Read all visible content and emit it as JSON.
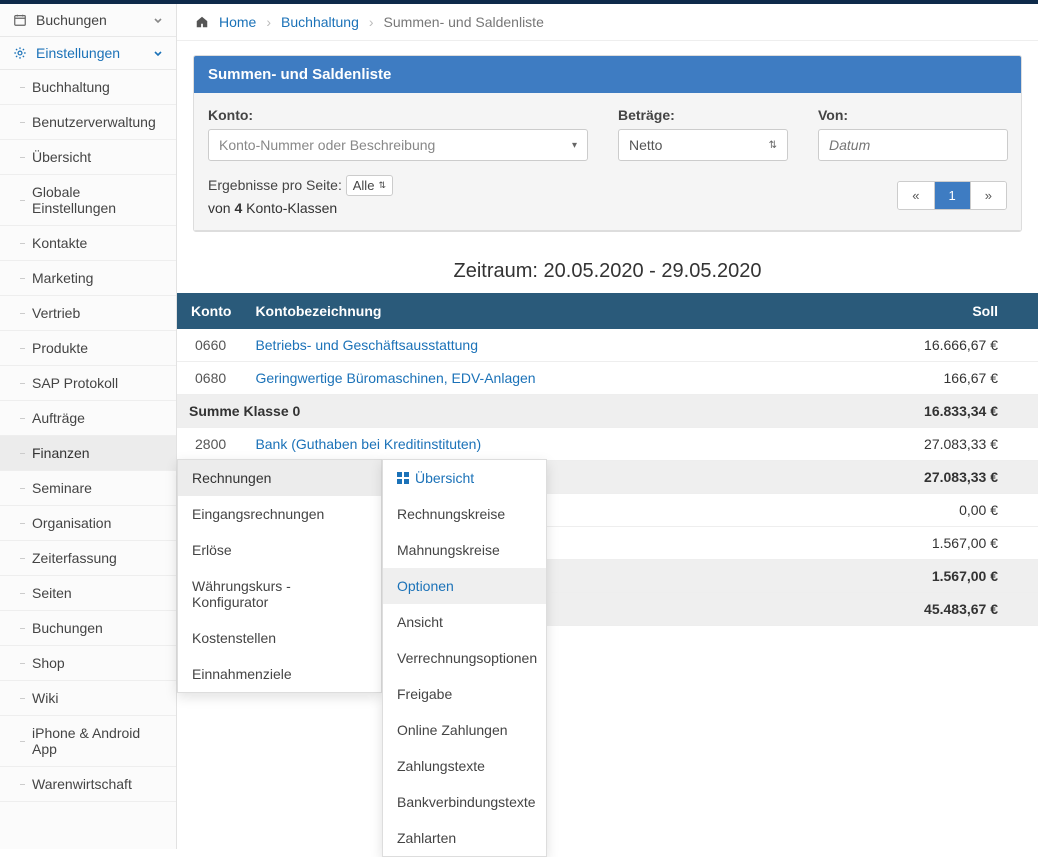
{
  "sidebar": {
    "groups": [
      {
        "icon": "calendar",
        "label": "Buchungen",
        "expanded": false
      },
      {
        "icon": "gear",
        "label": "Einstellungen",
        "expanded": true,
        "active": true,
        "items": [
          {
            "label": "Buchhaltung"
          },
          {
            "label": "Benutzerverwaltung"
          },
          {
            "label": "Übersicht"
          },
          {
            "label": "Globale Einstellungen"
          },
          {
            "label": "Kontakte"
          },
          {
            "label": "Marketing"
          },
          {
            "label": "Vertrieb"
          },
          {
            "label": "Produkte"
          },
          {
            "label": "SAP Protokoll"
          },
          {
            "label": "Aufträge"
          },
          {
            "label": "Finanzen",
            "active": true
          },
          {
            "label": "Seminare"
          },
          {
            "label": "Organisation"
          },
          {
            "label": "Zeiterfassung"
          },
          {
            "label": "Seiten"
          },
          {
            "label": "Buchungen"
          },
          {
            "label": "Shop"
          },
          {
            "label": "Wiki"
          },
          {
            "label": "iPhone & Android App"
          },
          {
            "label": "Warenwirtschaft"
          }
        ]
      }
    ]
  },
  "breadcrumb": {
    "home": "Home",
    "mid": "Buchhaltung",
    "tail": "Summen- und Saldenliste"
  },
  "panel": {
    "title": "Summen- und Saldenliste",
    "konto_label": "Konto:",
    "konto_placeholder": "Konto-Nummer oder Beschreibung",
    "betraege_label": "Beträge:",
    "betraege_value": "Netto",
    "von_label": "Von:",
    "von_placeholder": "Datum",
    "results_prefix": "Ergebnisse pro Seite:",
    "results_select": "Alle",
    "results_line2_pre": "von ",
    "results_count": "4",
    "results_line2_post": " Konto-Klassen",
    "pager_prev": "«",
    "pager_page": "1",
    "pager_next": "»"
  },
  "zeitraum": "Zeitraum: 20.05.2020 - 29.05.2020",
  "table": {
    "headers": {
      "konto": "Konto",
      "bez": "Kontobezeichnung",
      "soll": "Soll"
    },
    "rows": [
      {
        "type": "d",
        "acc": "0660",
        "desc": "Betriebs- und Geschäftsausstattung",
        "soll": "16.666,67 €"
      },
      {
        "type": "d",
        "acc": "0680",
        "desc": "Geringwertige Büromaschinen, EDV-Anlagen",
        "soll": "166,67 €"
      },
      {
        "type": "s",
        "desc": "Summe Klasse 0",
        "soll": "16.833,34 €"
      },
      {
        "type": "d",
        "acc": "2800",
        "desc": "Bank (Guthaben bei Kreditinstituten)",
        "soll": "27.083,33 €"
      },
      {
        "type": "s",
        "desc": "Summe Klasse 2",
        "soll": "27.083,33 €"
      },
      {
        "type": "d",
        "acc": "",
        "desc": "",
        "soll": "0,00 €"
      },
      {
        "type": "d",
        "acc": "",
        "desc": "",
        "soll": "1.567,00 €"
      },
      {
        "type": "s",
        "desc": "",
        "soll": "1.567,00 €"
      },
      {
        "type": "s",
        "desc": "",
        "soll": "45.483,67 €"
      }
    ]
  },
  "flyout1": [
    {
      "label": "Rechnungen",
      "active": true
    },
    {
      "label": "Eingangsrechnungen"
    },
    {
      "label": "Erlöse"
    },
    {
      "label": "Währungskurs - Konfigurator"
    },
    {
      "label": "Kostenstellen"
    },
    {
      "label": "Einnahmenziele"
    }
  ],
  "flyout2": [
    {
      "label": "Übersicht",
      "overview": true
    },
    {
      "label": "Rechnungskreise"
    },
    {
      "label": "Mahnungskreise"
    },
    {
      "label": "Optionen",
      "hover": true
    },
    {
      "label": "Ansicht"
    },
    {
      "label": "Verrechnungsoptionen"
    },
    {
      "label": "Freigabe"
    },
    {
      "label": "Online Zahlungen"
    },
    {
      "label": "Zahlungstexte"
    },
    {
      "label": "Bankverbindungstexte"
    },
    {
      "label": "Zahlarten"
    }
  ]
}
